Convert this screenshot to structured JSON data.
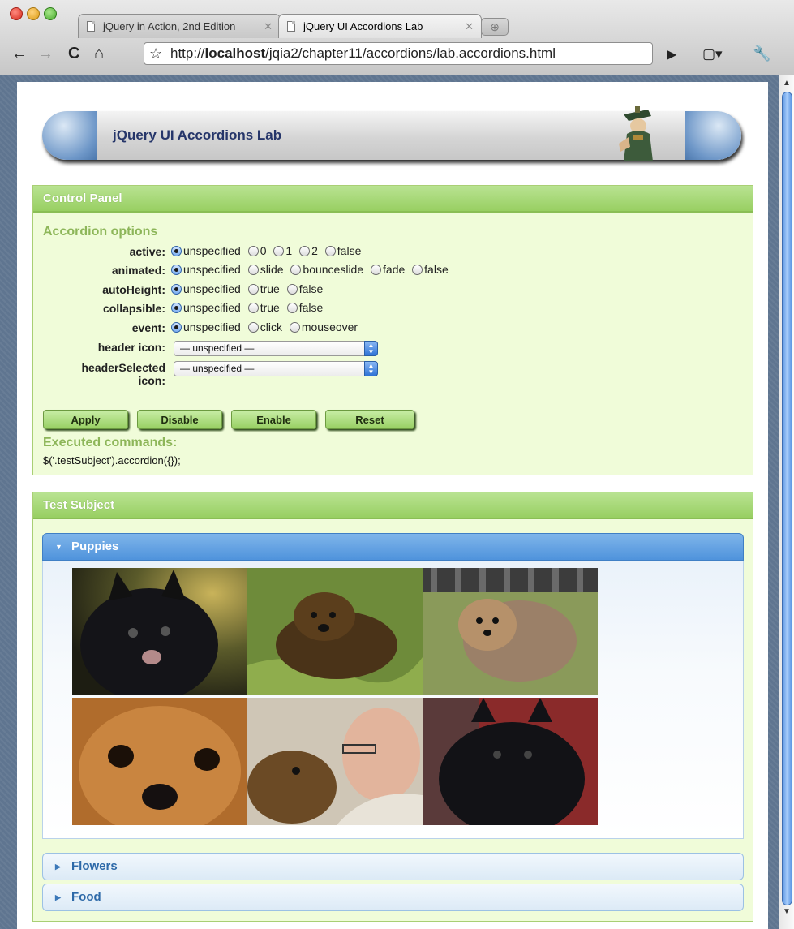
{
  "browser": {
    "tabs": [
      {
        "label": "jQuery in Action, 2nd Edition",
        "active": false
      },
      {
        "label": "jQuery UI Accordions Lab",
        "active": true
      }
    ],
    "url_prefix": "http://",
    "url_host": "localhost",
    "url_path": "/jqia2/chapter11/accordions/lab.accordions.html",
    "icons": [
      "back-icon",
      "forward-icon",
      "reload-icon",
      "home-icon",
      "star-icon",
      "play-icon",
      "page-menu-icon",
      "wrench-icon"
    ]
  },
  "banner": {
    "title": "jQuery UI Accordions Lab"
  },
  "control_panel": {
    "header": "Control Panel",
    "options_title": "Accordion options",
    "rows": [
      {
        "label": "active:",
        "values": [
          "unspecified",
          "0",
          "1",
          "2",
          "false"
        ],
        "selected": 0
      },
      {
        "label": "animated:",
        "values": [
          "unspecified",
          "slide",
          "bounceslide",
          "fade",
          "false"
        ],
        "selected": 0
      },
      {
        "label": "autoHeight:",
        "values": [
          "unspecified",
          "true",
          "false"
        ],
        "selected": 0
      },
      {
        "label": "collapsible:",
        "values": [
          "unspecified",
          "true",
          "false"
        ],
        "selected": 0
      },
      {
        "label": "event:",
        "values": [
          "unspecified",
          "click",
          "mouseover"
        ],
        "selected": 0
      }
    ],
    "header_icon": {
      "label": "header icon:",
      "value": "— unspecified —"
    },
    "header_selected_icon": {
      "label_line1": "headerSelected",
      "label_line2": "icon:",
      "value": "— unspecified —"
    },
    "buttons": {
      "apply": "Apply",
      "disable": "Disable",
      "enable": "Enable",
      "reset": "Reset"
    },
    "executed_title": "Executed commands:",
    "executed_command": "$('.testSubject').accordion({});"
  },
  "test_subject": {
    "header": "Test Subject",
    "sections": [
      {
        "label": "Puppies",
        "expanded": true
      },
      {
        "label": "Flowers",
        "expanded": false
      },
      {
        "label": "Food",
        "expanded": false
      }
    ],
    "photos": [
      "black-pomeranian-photo",
      "brown-puppy-in-grass-photo",
      "pomeranian-on-lawn-photo",
      "pomeranian-face-closeup-photo",
      "man-with-pomeranian-photo",
      "black-pomeranian-on-red-photo"
    ]
  },
  "colors": {
    "panel_green": "#98cf62",
    "panel_bg": "#f0fcd9",
    "accordion_blue": "#4f93dc",
    "title_navy": "#26366a"
  }
}
